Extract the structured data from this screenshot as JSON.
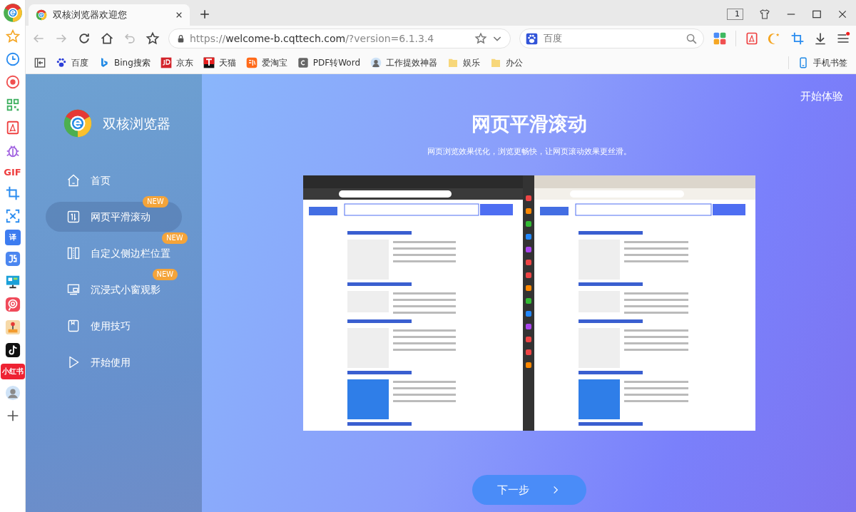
{
  "tabs": [
    {
      "title": "双核浏览器欢迎您",
      "selected": true
    }
  ],
  "tab_count": "1",
  "address": {
    "scheme": "https://",
    "host": "welcome-b.cqttech.com",
    "rest": "/?version=6.1.3.4"
  },
  "search": {
    "placeholder": "百度"
  },
  "bookmarks": [
    {
      "kind": "baidu",
      "label": "百度"
    },
    {
      "kind": "bing",
      "label": "Bing搜索"
    },
    {
      "kind": "jd",
      "label": "京东"
    },
    {
      "kind": "tmall",
      "label": "天猫"
    },
    {
      "kind": "taobao",
      "label": "爱淘宝"
    },
    {
      "kind": "pdf",
      "label": "PDF转Word"
    },
    {
      "kind": "person",
      "label": "工作提效神器"
    },
    {
      "kind": "folder",
      "label": "娱乐"
    },
    {
      "kind": "folder",
      "label": "办公"
    }
  ],
  "mobile_bookmarks": "手机书签",
  "side_apps": [
    {
      "kind": "star"
    },
    {
      "kind": "clock"
    },
    {
      "kind": "record"
    },
    {
      "kind": "qr"
    },
    {
      "kind": "pdf"
    },
    {
      "kind": "bug"
    },
    {
      "kind": "gif",
      "text": "GIF"
    },
    {
      "kind": "crop"
    },
    {
      "kind": "scan"
    },
    {
      "kind": "translate",
      "text": "译"
    },
    {
      "kind": "js"
    },
    {
      "kind": "monitor"
    },
    {
      "kind": "ring"
    },
    {
      "kind": "joystick"
    },
    {
      "kind": "note"
    },
    {
      "kind": "xhs",
      "text": "小红书"
    },
    {
      "kind": "avatar"
    },
    {
      "kind": "plus"
    }
  ],
  "welcome": {
    "brand": "双核浏览器",
    "nav": [
      {
        "kind": "home",
        "label": "首页",
        "selected": false,
        "is_new": false
      },
      {
        "kind": "scroll",
        "label": "网页平滑滚动",
        "selected": true,
        "is_new": true,
        "badge": "NEW"
      },
      {
        "kind": "sidebar",
        "label": "自定义侧边栏位置",
        "selected": false,
        "is_new": true,
        "badge": "NEW"
      },
      {
        "kind": "window",
        "label": "沉浸式小窗观影",
        "selected": false,
        "is_new": true,
        "badge": "NEW"
      },
      {
        "kind": "book",
        "label": "使用技巧",
        "selected": false,
        "is_new": false
      },
      {
        "kind": "play",
        "label": "开始使用",
        "selected": false,
        "is_new": false
      }
    ],
    "start_link": "开始体验",
    "heading": "网页平滑滚动",
    "subtitle": "网页浏览效果优化，浏览更畅快，让网页滚动效果更丝滑。",
    "next_button": "下一步"
  }
}
